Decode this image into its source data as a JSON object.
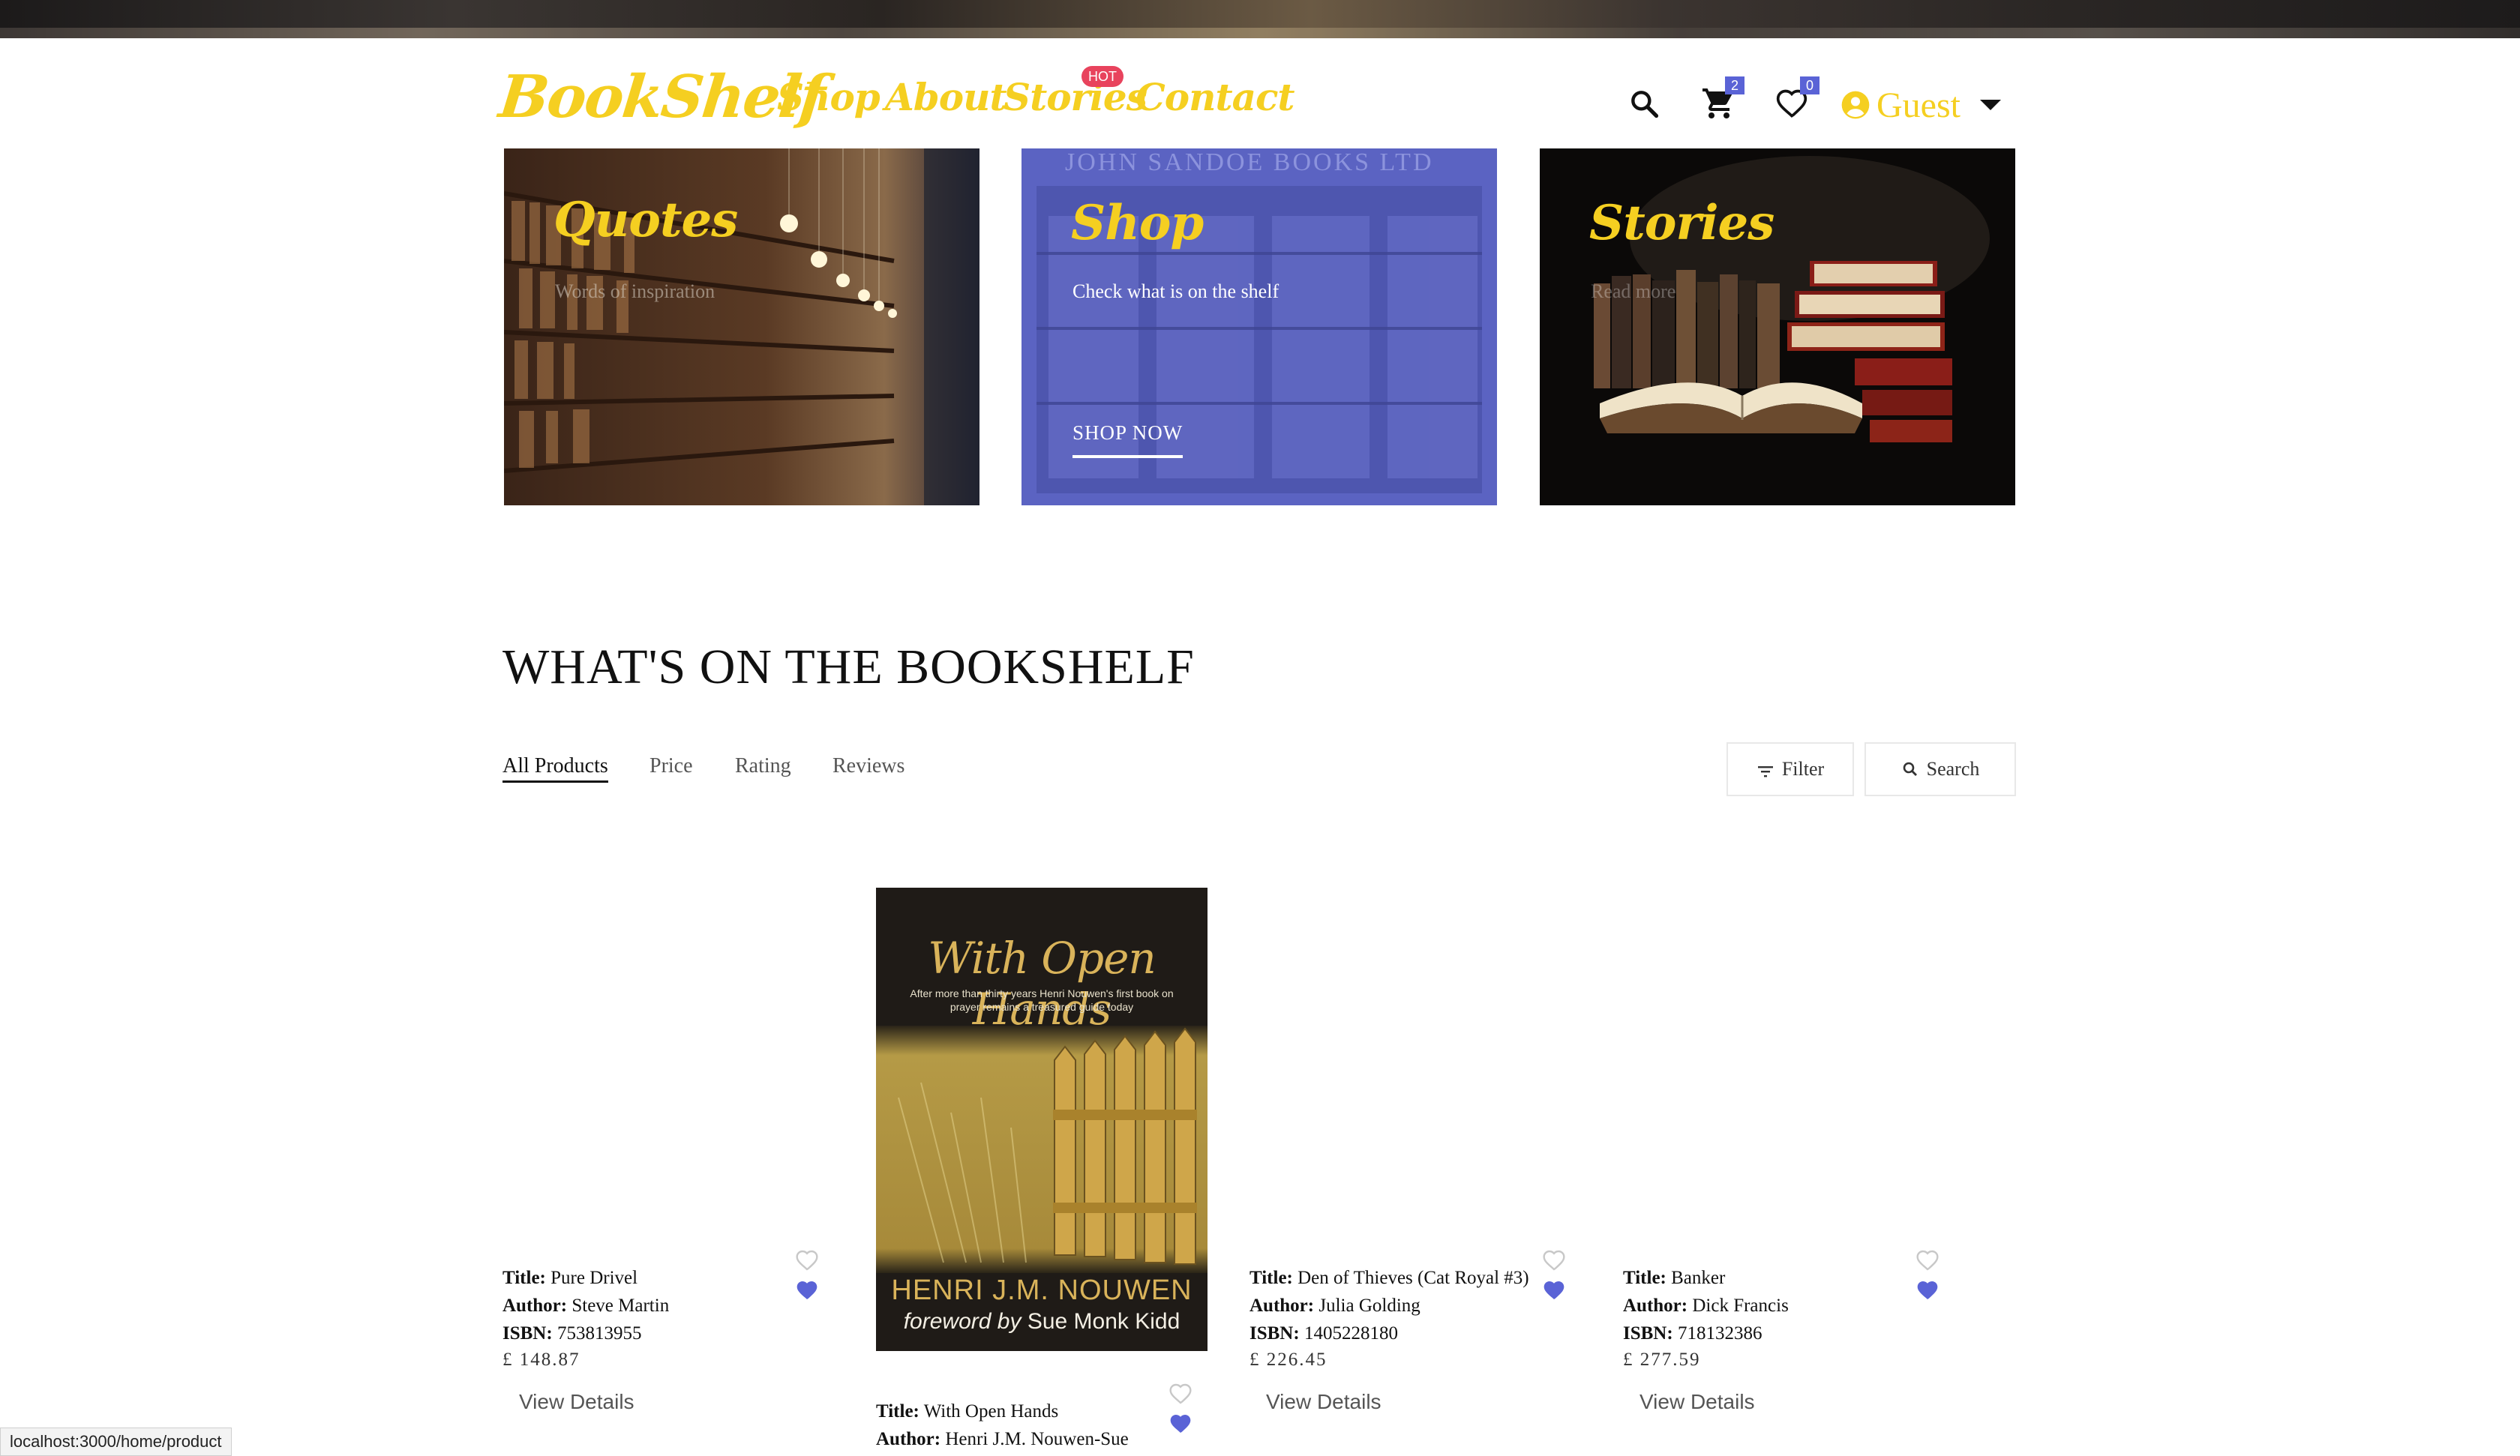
{
  "brand": {
    "logo": "BookShelf"
  },
  "nav": {
    "items": [
      "Shop",
      "About",
      "Stories",
      "Contact"
    ],
    "hot_badge": "HOT"
  },
  "header": {
    "cart_count": "2",
    "wishlist_count": "0",
    "user_label": "Guest",
    "icons": [
      "search-icon",
      "cart-icon",
      "heart-icon",
      "account-icon",
      "caret-down-icon"
    ]
  },
  "banners": [
    {
      "title": "Quotes",
      "subtitle": "Words of inspiration"
    },
    {
      "title": "Shop",
      "subtitle": "Check what is on the shelf",
      "cta": "SHOP NOW",
      "sign": "JOHN SANDOE BOOKS LTD"
    },
    {
      "title": "Stories",
      "subtitle": "Read more"
    }
  ],
  "section": {
    "title": "WHAT'S ON THE BOOKSHELF",
    "tabs": [
      "All Products",
      "Price",
      "Rating",
      "Reviews"
    ],
    "active_tab": "All Products",
    "filter_label": "Filter",
    "search_label": "Search"
  },
  "labels": {
    "title": "Title:",
    "author": "Author:",
    "isbn": "ISBN:",
    "view_details": "View Details"
  },
  "products": [
    {
      "title": "Pure Drivel",
      "author": "Steve Martin",
      "isbn": "753813955",
      "price": "£ 148.87"
    },
    {
      "title": "With Open Hands",
      "author": "Henri J.M. Nouwen-Sue"
    },
    {
      "title": "Den of Thieves (Cat Royal #3)",
      "author": "Julia Golding",
      "isbn": "1405228180",
      "price": "£ 226.45"
    },
    {
      "title": "Banker",
      "author": "Dick Francis",
      "isbn": "718132386",
      "price": "£ 277.59"
    }
  ],
  "cover": {
    "title": "With Open Hands",
    "subtitle": "After more than thirty years Henri Nouwen's first book on prayer remains a treasured guide today",
    "author": "HENRI J.M. NOUWEN",
    "foreword_prefix": "foreword by",
    "foreword_name": "Sue Monk Kidd"
  },
  "status_url": "localhost:3000/home/product",
  "colors": {
    "accent": "#f5cf21",
    "badge": "#5a63d6",
    "hot": "#e8435d",
    "heart_fill": "#5a63d6"
  }
}
